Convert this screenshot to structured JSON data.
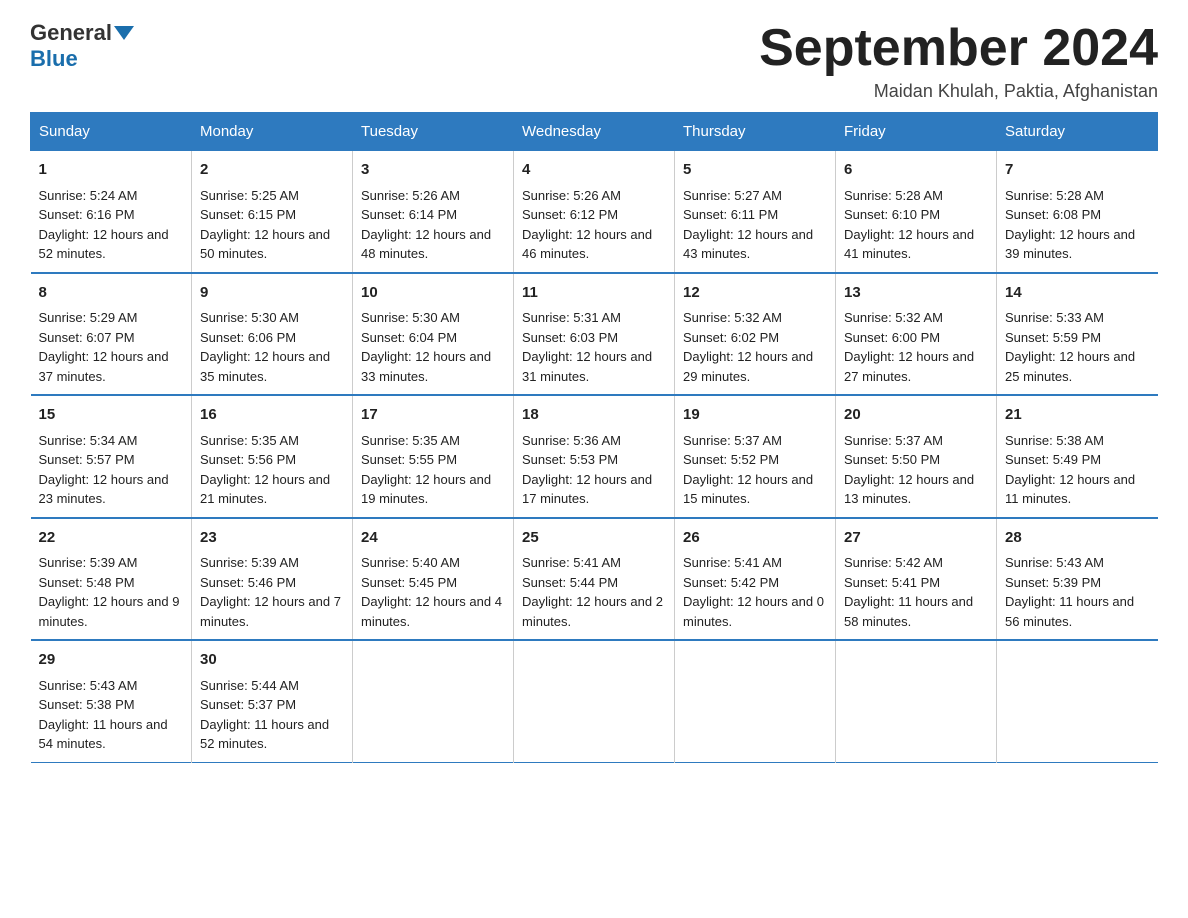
{
  "logo": {
    "general": "General",
    "blue": "Blue",
    "sub": "Blue"
  },
  "title": "September 2024",
  "location": "Maidan Khulah, Paktia, Afghanistan",
  "days_of_week": [
    "Sunday",
    "Monday",
    "Tuesday",
    "Wednesday",
    "Thursday",
    "Friday",
    "Saturday"
  ],
  "weeks": [
    [
      {
        "day": "1",
        "sunrise": "5:24 AM",
        "sunset": "6:16 PM",
        "daylight": "12 hours and 52 minutes."
      },
      {
        "day": "2",
        "sunrise": "5:25 AM",
        "sunset": "6:15 PM",
        "daylight": "12 hours and 50 minutes."
      },
      {
        "day": "3",
        "sunrise": "5:26 AM",
        "sunset": "6:14 PM",
        "daylight": "12 hours and 48 minutes."
      },
      {
        "day": "4",
        "sunrise": "5:26 AM",
        "sunset": "6:12 PM",
        "daylight": "12 hours and 46 minutes."
      },
      {
        "day": "5",
        "sunrise": "5:27 AM",
        "sunset": "6:11 PM",
        "daylight": "12 hours and 43 minutes."
      },
      {
        "day": "6",
        "sunrise": "5:28 AM",
        "sunset": "6:10 PM",
        "daylight": "12 hours and 41 minutes."
      },
      {
        "day": "7",
        "sunrise": "5:28 AM",
        "sunset": "6:08 PM",
        "daylight": "12 hours and 39 minutes."
      }
    ],
    [
      {
        "day": "8",
        "sunrise": "5:29 AM",
        "sunset": "6:07 PM",
        "daylight": "12 hours and 37 minutes."
      },
      {
        "day": "9",
        "sunrise": "5:30 AM",
        "sunset": "6:06 PM",
        "daylight": "12 hours and 35 minutes."
      },
      {
        "day": "10",
        "sunrise": "5:30 AM",
        "sunset": "6:04 PM",
        "daylight": "12 hours and 33 minutes."
      },
      {
        "day": "11",
        "sunrise": "5:31 AM",
        "sunset": "6:03 PM",
        "daylight": "12 hours and 31 minutes."
      },
      {
        "day": "12",
        "sunrise": "5:32 AM",
        "sunset": "6:02 PM",
        "daylight": "12 hours and 29 minutes."
      },
      {
        "day": "13",
        "sunrise": "5:32 AM",
        "sunset": "6:00 PM",
        "daylight": "12 hours and 27 minutes."
      },
      {
        "day": "14",
        "sunrise": "5:33 AM",
        "sunset": "5:59 PM",
        "daylight": "12 hours and 25 minutes."
      }
    ],
    [
      {
        "day": "15",
        "sunrise": "5:34 AM",
        "sunset": "5:57 PM",
        "daylight": "12 hours and 23 minutes."
      },
      {
        "day": "16",
        "sunrise": "5:35 AM",
        "sunset": "5:56 PM",
        "daylight": "12 hours and 21 minutes."
      },
      {
        "day": "17",
        "sunrise": "5:35 AM",
        "sunset": "5:55 PM",
        "daylight": "12 hours and 19 minutes."
      },
      {
        "day": "18",
        "sunrise": "5:36 AM",
        "sunset": "5:53 PM",
        "daylight": "12 hours and 17 minutes."
      },
      {
        "day": "19",
        "sunrise": "5:37 AM",
        "sunset": "5:52 PM",
        "daylight": "12 hours and 15 minutes."
      },
      {
        "day": "20",
        "sunrise": "5:37 AM",
        "sunset": "5:50 PM",
        "daylight": "12 hours and 13 minutes."
      },
      {
        "day": "21",
        "sunrise": "5:38 AM",
        "sunset": "5:49 PM",
        "daylight": "12 hours and 11 minutes."
      }
    ],
    [
      {
        "day": "22",
        "sunrise": "5:39 AM",
        "sunset": "5:48 PM",
        "daylight": "12 hours and 9 minutes."
      },
      {
        "day": "23",
        "sunrise": "5:39 AM",
        "sunset": "5:46 PM",
        "daylight": "12 hours and 7 minutes."
      },
      {
        "day": "24",
        "sunrise": "5:40 AM",
        "sunset": "5:45 PM",
        "daylight": "12 hours and 4 minutes."
      },
      {
        "day": "25",
        "sunrise": "5:41 AM",
        "sunset": "5:44 PM",
        "daylight": "12 hours and 2 minutes."
      },
      {
        "day": "26",
        "sunrise": "5:41 AM",
        "sunset": "5:42 PM",
        "daylight": "12 hours and 0 minutes."
      },
      {
        "day": "27",
        "sunrise": "5:42 AM",
        "sunset": "5:41 PM",
        "daylight": "11 hours and 58 minutes."
      },
      {
        "day": "28",
        "sunrise": "5:43 AM",
        "sunset": "5:39 PM",
        "daylight": "11 hours and 56 minutes."
      }
    ],
    [
      {
        "day": "29",
        "sunrise": "5:43 AM",
        "sunset": "5:38 PM",
        "daylight": "11 hours and 54 minutes."
      },
      {
        "day": "30",
        "sunrise": "5:44 AM",
        "sunset": "5:37 PM",
        "daylight": "11 hours and 52 minutes."
      },
      {
        "day": "",
        "sunrise": "",
        "sunset": "",
        "daylight": ""
      },
      {
        "day": "",
        "sunrise": "",
        "sunset": "",
        "daylight": ""
      },
      {
        "day": "",
        "sunrise": "",
        "sunset": "",
        "daylight": ""
      },
      {
        "day": "",
        "sunrise": "",
        "sunset": "",
        "daylight": ""
      },
      {
        "day": "",
        "sunrise": "",
        "sunset": "",
        "daylight": ""
      }
    ]
  ],
  "sunrise_label": "Sunrise:",
  "sunset_label": "Sunset:",
  "daylight_label": "Daylight:"
}
